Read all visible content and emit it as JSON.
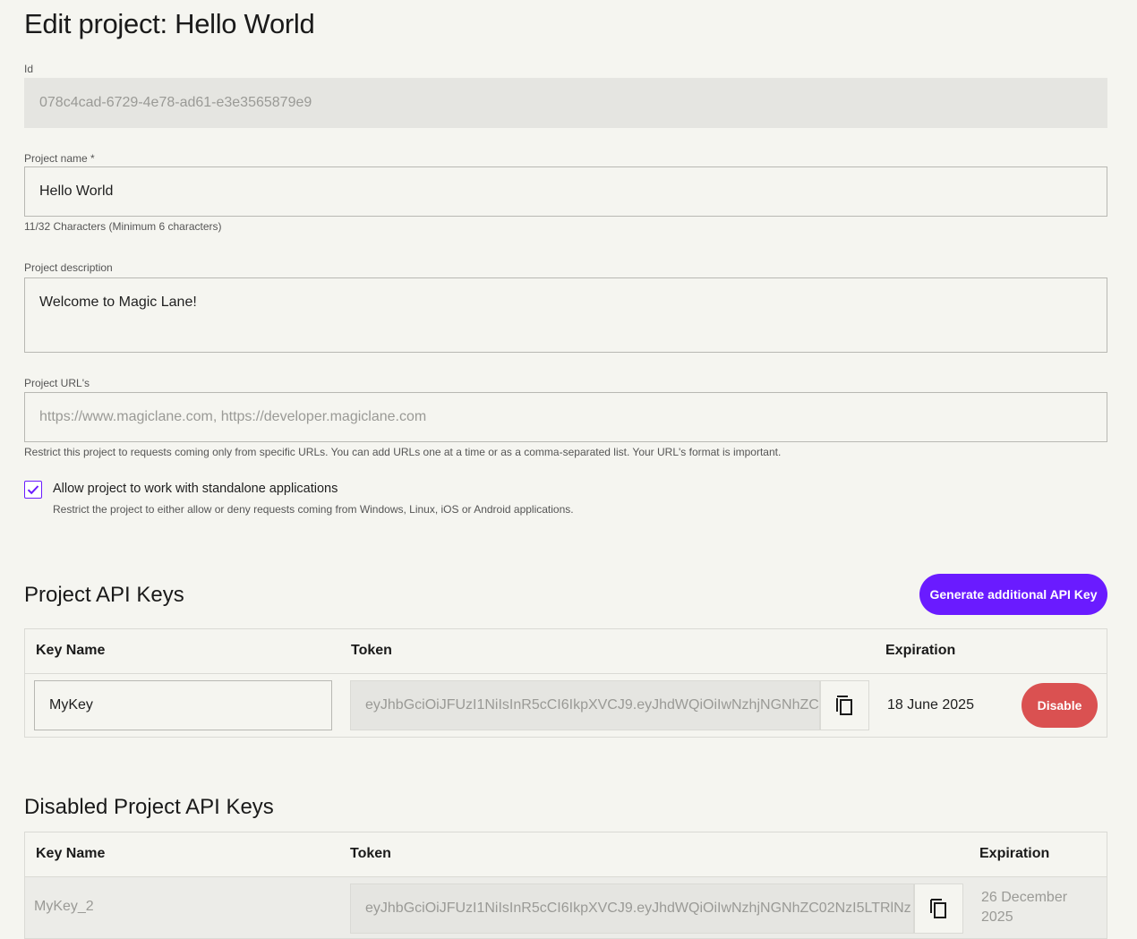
{
  "page": {
    "title": "Edit project: Hello World"
  },
  "form": {
    "id": {
      "label": "Id",
      "value": "078c4cad-6729-4e78-ad61-e3e3565879e9"
    },
    "name": {
      "label": "Project name *",
      "value": "Hello World",
      "hint": "11/32 Characters (Minimum 6 characters)"
    },
    "description": {
      "label": "Project description",
      "value": "Welcome to Magic Lane!"
    },
    "urls": {
      "label": "Project URL's",
      "placeholder": "https://www.magiclane.com, https://developer.magiclane.com",
      "hint": "Restrict this project to requests coming only from specific URLs. You can add URLs one at a time or as a comma-separated list. Your URL's format is important."
    },
    "standalone": {
      "checked": true,
      "label": "Allow project to work with standalone applications",
      "hint": "Restrict the project to either allow or deny requests coming from Windows, Linux, iOS or Android applications."
    }
  },
  "api_keys": {
    "title": "Project API Keys",
    "generate_label": "Generate additional API Key",
    "columns": {
      "key_name": "Key Name",
      "token": "Token",
      "expiration": "Expiration"
    },
    "rows": [
      {
        "key_name": "MyKey",
        "token": "eyJhbGciOiJFUzI1NiIsInR5cCI6IkpXVCJ9.eyJhdWQiOiIwNzhjNGNhZC",
        "expiration": "18 June 2025",
        "action_label": "Disable"
      }
    ]
  },
  "disabled_keys": {
    "title": "Disabled Project API Keys",
    "columns": {
      "key_name": "Key Name",
      "token": "Token",
      "expiration": "Expiration"
    },
    "rows": [
      {
        "key_name": "MyKey_2",
        "token": "eyJhbGciOiJFUzI1NiIsInR5cCI6IkpXVCJ9.eyJhdWQiOiIwNzhjNGNhZC02NzI5LTRlNz",
        "expiration": "26 December 2025"
      }
    ]
  },
  "colors": {
    "accent": "#6a1bff",
    "danger": "#da5151",
    "background": "#f5f5f0",
    "readonly": "#e5e5e1"
  }
}
